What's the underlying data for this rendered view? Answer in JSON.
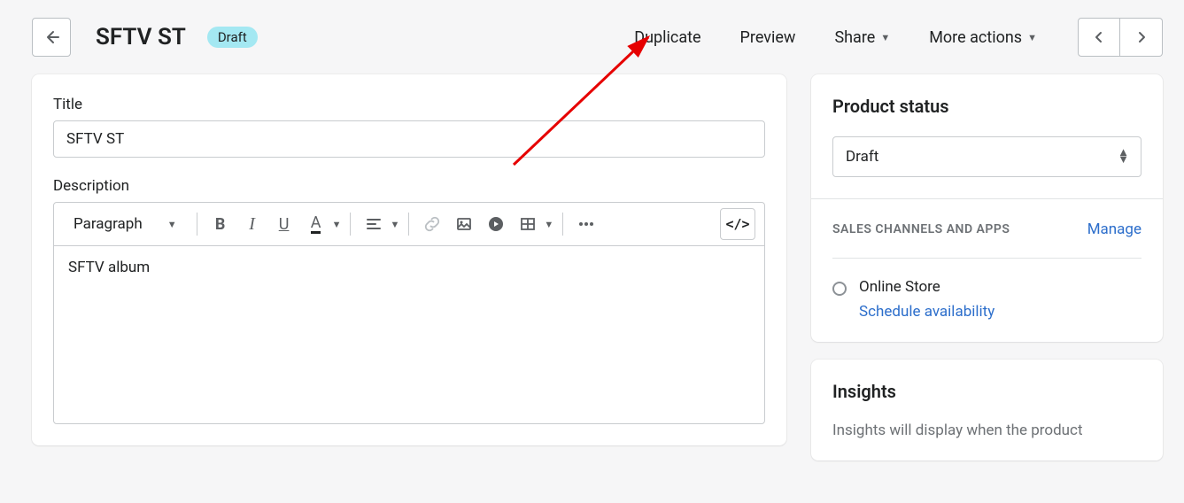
{
  "header": {
    "title": "SFTV ST",
    "badge": "Draft",
    "actions": {
      "duplicate": "Duplicate",
      "preview": "Preview",
      "share": "Share",
      "more": "More actions"
    }
  },
  "main": {
    "title_label": "Title",
    "title_value": "SFTV ST",
    "description_label": "Description",
    "paragraph_label": "Paragraph",
    "description_value": "SFTV album",
    "code_button": "</>"
  },
  "sidebar": {
    "status_heading": "Product status",
    "status_value": "Draft",
    "channels_heading": "SALES CHANNELS AND APPS",
    "manage_link": "Manage",
    "channel_name": "Online Store",
    "schedule_link": "Schedule availability",
    "insights_heading": "Insights",
    "insights_text": "Insights will display when the product"
  }
}
